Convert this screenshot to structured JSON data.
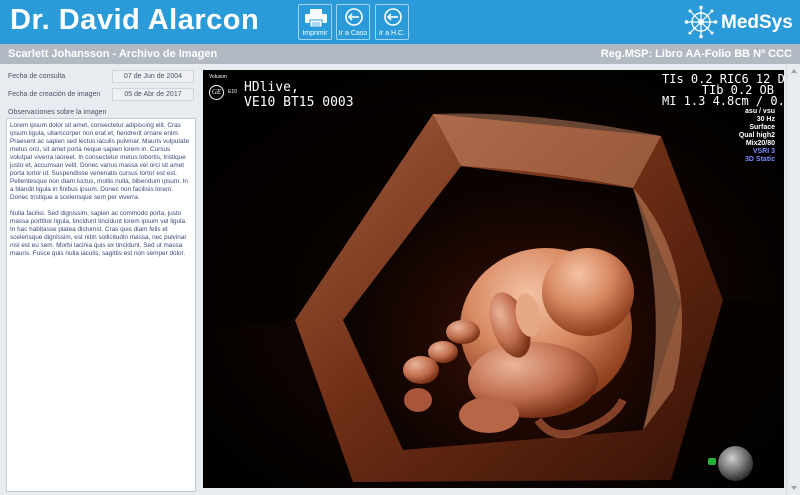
{
  "header": {
    "doctor_name": "Dr. David Alarcon",
    "buttons": {
      "print": "Imprimir",
      "case": "Ir a Caso",
      "hc": "Ir a H.C."
    },
    "logo_text": "MedSys",
    "bg_color": "#2a9ad8"
  },
  "subheader": {
    "patient_archive": "Scarlett Johansson - Archivo de Imagen",
    "registration": "Reg.MSP: Libro AA-Folio BB Nº CCC"
  },
  "left_panel": {
    "fields": [
      {
        "label": "Fecha de consulta",
        "value": "07 de Jun de 2004"
      },
      {
        "label": "Fecha de creación de imagen",
        "value": "05 de Abr de 2017"
      }
    ],
    "observations_label": "Observaciones sobre la imagen",
    "observations": [
      "Lorem ipsum dolor sit amet, consectetur adipiscing elit. Cras ipsum ligula, ullamcorper non erat et, hendrerit ornare enim. Praesent ac sapien sed lectus iaculis pulvinar. Mauris vulputate metus orci, sit amet porta neque sapien lorem in. Cursus volutpat viverra laoreet. In consectetur metus lobortis, tristique justo et, accumsan velit. Donec varius massa vel orci sit amet porta tortor id. Suspendisse venenatis cursus tortor est est. Pellentesque non diam luctus, mollis nulla, bibendum ipsum. In a blandit ligula in finibus ipsum. Donec non facilisis lorem. Donec tristique a scelerisque sem per viverra.",
      "Nulla facilisi. Sed dignissim, sapien ac commodo porta, justo massa porttitor ligula, tincidunt tincidunt lorem ipsum vel ligula. In hac habitasse platea dictumst. Cras quis diam felis et scelerisque dignissim, est nibh sollicitudin massa, nec pulvinar nisl est eu sem. Morbi lacinia quis ex tincidunt. Sed ut massa mauris. Fusce quis nulla iaculis, sagittis est non semper dolor."
    ]
  },
  "ultrasound": {
    "volume_label": "Voluson",
    "ge_number": "E10",
    "mode_line1": "HDlive,",
    "mode_line2": "VE10 BT15 0003",
    "params": [
      "TIs 0.2  RIC6 12 D",
      "TIb 0.2       OB",
      "MI 1.3 4.8cm / 0.9"
    ],
    "settings": [
      "Qual high2",
      "Mix20/80",
      "VSRI 3",
      "3D Static"
    ],
    "settings_top": [
      "asu / vsu",
      "30 Hz",
      "Surface"
    ],
    "orientation_marker_color": "#22b43a"
  }
}
